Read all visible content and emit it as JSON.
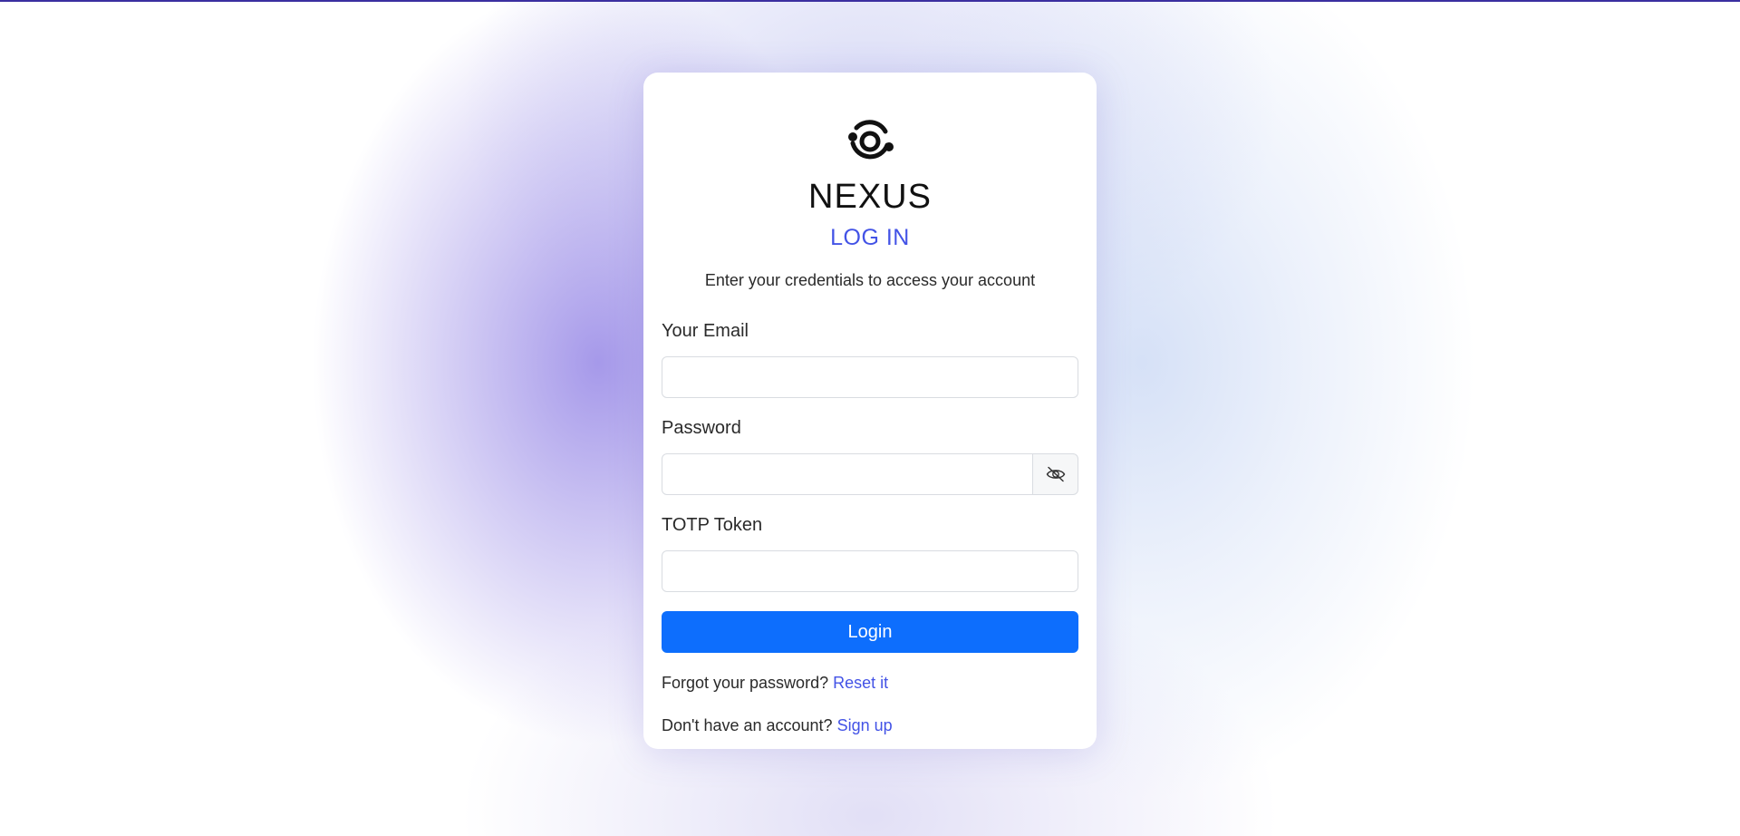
{
  "app": {
    "brand": "NEXUS",
    "subtitle": "LOG IN",
    "description": "Enter your credentials to access your account",
    "accent_color": "#4353e6",
    "button_color": "#0d6efd"
  },
  "form": {
    "email_label": "Your Email",
    "email_value": "",
    "password_label": "Password",
    "password_value": "",
    "password_toggle_icon": "eye-slash-icon",
    "totp_label": "TOTP Token",
    "totp_value": "",
    "login_label": "Login"
  },
  "links": {
    "forgot_text": "Forgot your password?",
    "reset_label": "Reset it",
    "signup_text": "Don't have an account?",
    "signup_label": "Sign up"
  }
}
